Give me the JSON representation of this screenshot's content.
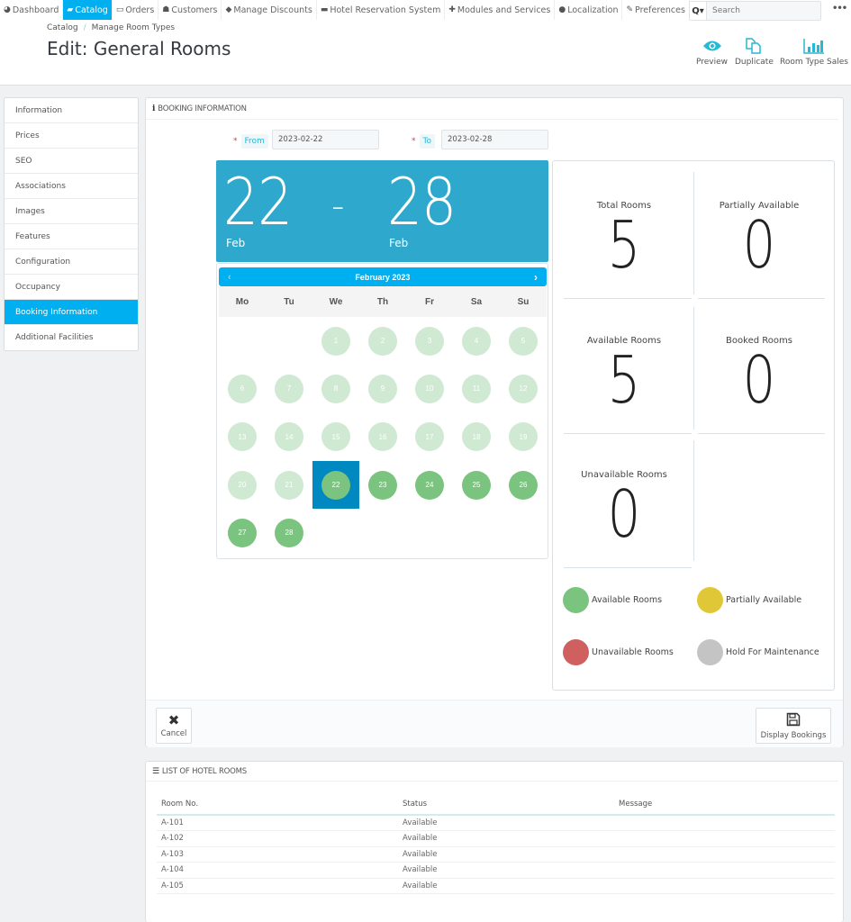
{
  "topnav": {
    "items": [
      {
        "label": "Dashboard",
        "icon": "dashboard-icon",
        "glyph": "◕",
        "active": false
      },
      {
        "label": "Catalog",
        "icon": "book-icon",
        "glyph": "▰",
        "active": true
      },
      {
        "label": "Orders",
        "icon": "credit-card-icon",
        "glyph": "▭",
        "active": false
      },
      {
        "label": "Customers",
        "icon": "users-icon",
        "glyph": "☗",
        "active": false
      },
      {
        "label": "Manage Discounts",
        "icon": "tags-icon",
        "glyph": "◆",
        "active": false
      },
      {
        "label": "Hotel Reservation System",
        "icon": "bed-icon",
        "glyph": "▬",
        "active": false
      },
      {
        "label": "Modules and Services",
        "icon": "puzzle-icon",
        "glyph": "✚",
        "active": false
      },
      {
        "label": "Localization",
        "icon": "globe-icon",
        "glyph": "●",
        "active": false
      },
      {
        "label": "Preferences",
        "icon": "wrench-icon",
        "glyph": "✎",
        "active": false
      }
    ],
    "search_placeholder": "Search",
    "search_icon": "Q▾",
    "more": "•••"
  },
  "breadcrumb": {
    "items": [
      "Catalog",
      "Manage Room Types"
    ],
    "separator": "/"
  },
  "page_title": "Edit: General Rooms",
  "toolbar": {
    "preview": "Preview",
    "duplicate": "Duplicate",
    "room_type_sales": "Room Type Sales"
  },
  "sidebar": {
    "items": [
      {
        "label": "Information",
        "active": false
      },
      {
        "label": "Prices",
        "active": false
      },
      {
        "label": "SEO",
        "active": false
      },
      {
        "label": "Associations",
        "active": false
      },
      {
        "label": "Images",
        "active": false
      },
      {
        "label": "Features",
        "active": false
      },
      {
        "label": "Configuration",
        "active": false
      },
      {
        "label": "Occupancy",
        "active": false
      },
      {
        "label": "Booking Information",
        "active": true
      },
      {
        "label": "Additional Facilities",
        "active": false
      }
    ]
  },
  "booking": {
    "heading": "BOOKING INFORMATION",
    "from_label": "From",
    "to_label": "To",
    "required_mark": "*",
    "from_value": "2023-02-22",
    "to_value": "2023-02-28",
    "range": {
      "start_day": "22",
      "start_month": "Feb",
      "end_day": "28",
      "end_month": "Feb",
      "dash": "-"
    },
    "calendar": {
      "month_label": "February 2023",
      "prev": "‹",
      "next": "›",
      "weekdays": [
        "Mo",
        "Tu",
        "We",
        "Th",
        "Fr",
        "Sa",
        "Su"
      ],
      "leading_blanks": 2,
      "days_in_month": 28,
      "past_until": 21,
      "selected_day": 22
    },
    "stats": [
      {
        "label": "Total Rooms",
        "value": "5"
      },
      {
        "label": "Partially Available",
        "value": "0"
      },
      {
        "label": "Available Rooms",
        "value": "5"
      },
      {
        "label": "Booked Rooms",
        "value": "0"
      },
      {
        "label": "Unavailable Rooms",
        "value": "0"
      }
    ],
    "legend": [
      {
        "label": "Available Rooms",
        "color": "#7ac47f"
      },
      {
        "label": "Partially Available",
        "color": "#e0c737"
      },
      {
        "label": "Unavailable Rooms",
        "color": "#d05f5f"
      },
      {
        "label": "Hold For Maintenance",
        "color": "#c4c4c4"
      }
    ],
    "cancel_label": "Cancel",
    "display_bookings_label": "Display Bookings"
  },
  "rooms_list": {
    "heading": "LIST OF HOTEL ROOMS",
    "columns": [
      "Room No.",
      "Status",
      "Message"
    ],
    "rows": [
      {
        "room": "A-101",
        "status": "Available",
        "message": ""
      },
      {
        "room": "A-102",
        "status": "Available",
        "message": ""
      },
      {
        "room": "A-103",
        "status": "Available",
        "message": ""
      },
      {
        "room": "A-104",
        "status": "Available",
        "message": ""
      },
      {
        "room": "A-105",
        "status": "Available",
        "message": ""
      }
    ]
  }
}
